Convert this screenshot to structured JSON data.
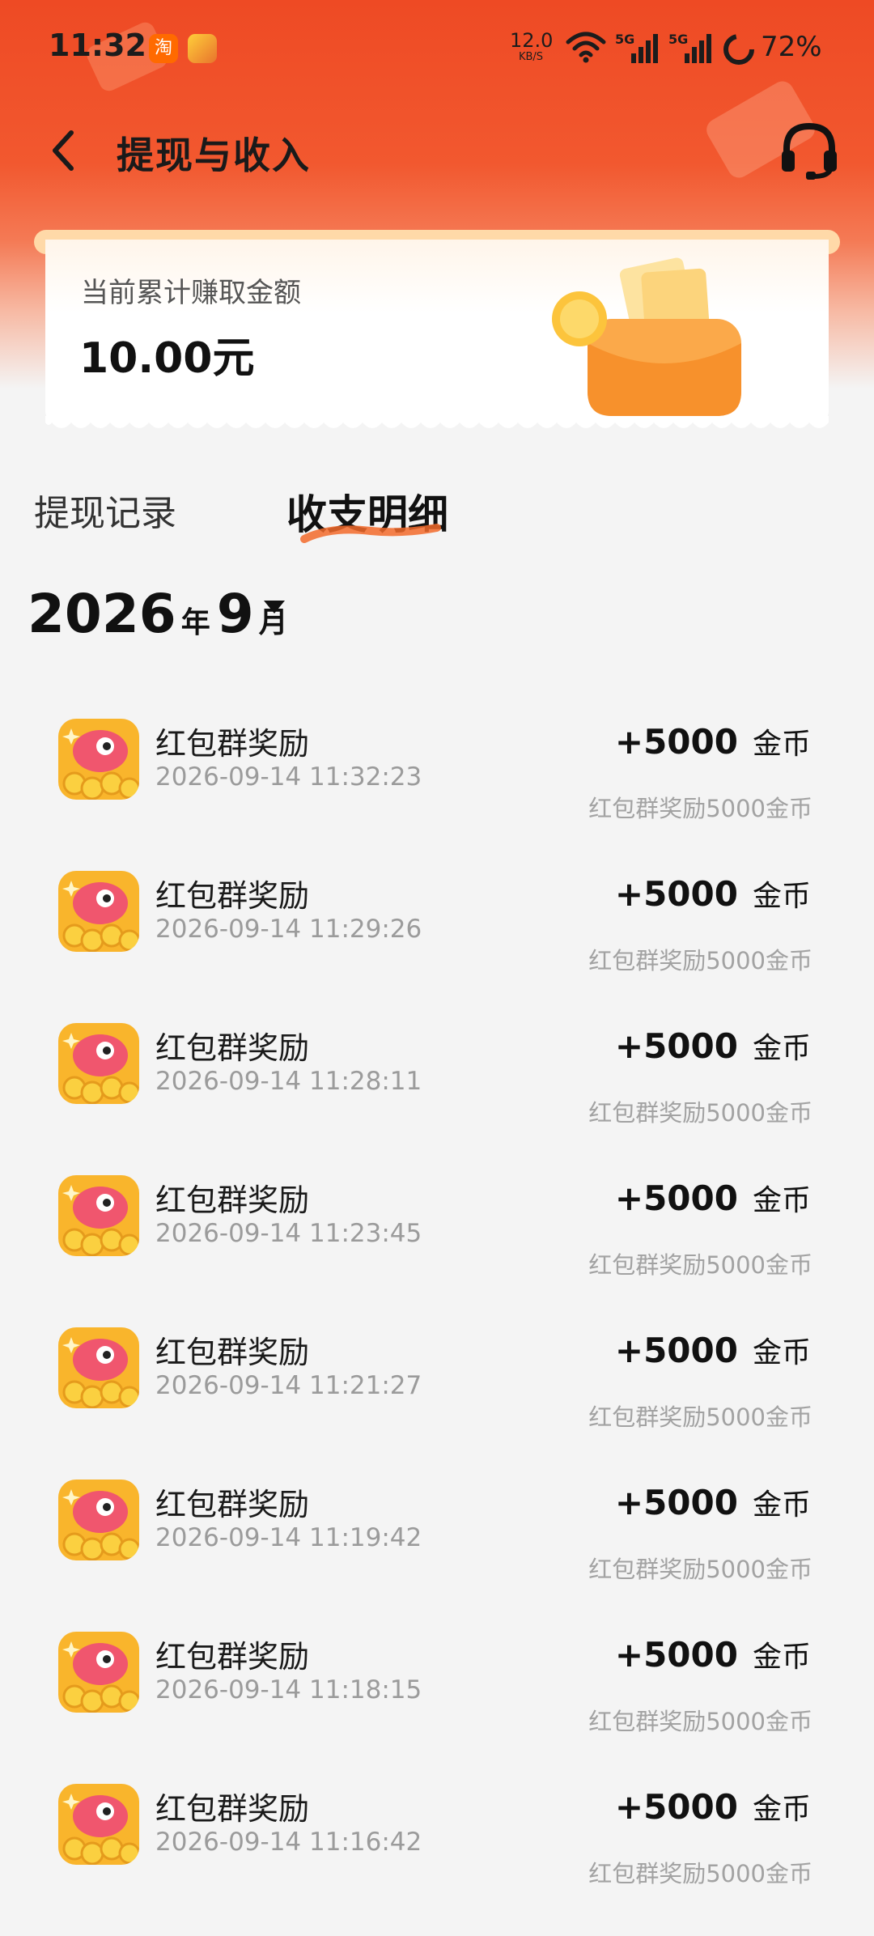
{
  "status_bar": {
    "time": "11:32",
    "app_icon_label": "淘",
    "net_speed": "12.0",
    "net_speed_unit": "KB/S",
    "signal1_label": "5G",
    "signal2_label": "5G",
    "battery": "72%"
  },
  "header": {
    "title": "提现与收入",
    "back_icon": "chevron-left-icon",
    "support_icon": "headset-icon"
  },
  "earnings_card": {
    "label": "当前累计赚取金额",
    "amount": "10.00元"
  },
  "tabs": [
    {
      "label": "提现记录",
      "active": false
    },
    {
      "label": "收支明细",
      "active": true
    }
  ],
  "month": {
    "year": "2026",
    "year_unit": "年",
    "month": "9",
    "month_unit": "月"
  },
  "transactions": [
    {
      "title": "红包群奖励",
      "time": "2026-09-14 11:32:23",
      "amount": "+5000",
      "unit": "金币",
      "desc": "红包群奖励5000金币"
    },
    {
      "title": "红包群奖励",
      "time": "2026-09-14 11:29:26",
      "amount": "+5000",
      "unit": "金币",
      "desc": "红包群奖励5000金币"
    },
    {
      "title": "红包群奖励",
      "time": "2026-09-14 11:28:11",
      "amount": "+5000",
      "unit": "金币",
      "desc": "红包群奖励5000金币"
    },
    {
      "title": "红包群奖励",
      "time": "2026-09-14 11:23:45",
      "amount": "+5000",
      "unit": "金币",
      "desc": "红包群奖励5000金币"
    },
    {
      "title": "红包群奖励",
      "time": "2026-09-14 11:21:27",
      "amount": "+5000",
      "unit": "金币",
      "desc": "红包群奖励5000金币"
    },
    {
      "title": "红包群奖励",
      "time": "2026-09-14 11:19:42",
      "amount": "+5000",
      "unit": "金币",
      "desc": "红包群奖励5000金币"
    },
    {
      "title": "红包群奖励",
      "time": "2026-09-14 11:18:15",
      "amount": "+5000",
      "unit": "金币",
      "desc": "红包群奖励5000金币"
    },
    {
      "title": "红包群奖励",
      "time": "2026-09-14 11:16:42",
      "amount": "+5000",
      "unit": "金币",
      "desc": "红包群奖励5000金币"
    }
  ],
  "colors": {
    "header_bg": "#ee4a24",
    "page_bg": "#f4f4f4",
    "accent_underline": "#f26a2a"
  }
}
